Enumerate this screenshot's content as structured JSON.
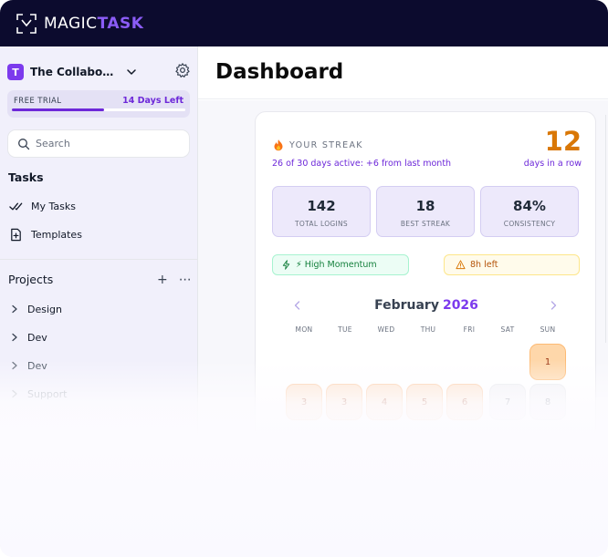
{
  "app": {
    "logo_magic": "MAGIC",
    "logo_task": "TASK",
    "accent": "#7c3aed"
  },
  "sidebar": {
    "workspace": {
      "initial": "T",
      "name": "The Collaborativ..."
    },
    "trial": {
      "label": "FREE TRIAL",
      "days_left": "14 Days Left",
      "progress_fraction": 0.53
    },
    "search": {
      "placeholder": "Search"
    },
    "tasks_title": "Tasks",
    "task_items": [
      {
        "label": "My Tasks",
        "icon": "double-check-icon"
      },
      {
        "label": "Templates",
        "icon": "add-document-icon"
      }
    ],
    "projects_title": "Projects",
    "projects": [
      {
        "label": "Design"
      },
      {
        "label": "Dev"
      },
      {
        "label": "Dev"
      },
      {
        "label": "Support"
      }
    ]
  },
  "main": {
    "title": "Dashboard",
    "streak": {
      "label": "YOUR STREAK",
      "subtitle": "26 of 30 days active: +6 from last month",
      "count": "12",
      "unit": "days in a row",
      "stats": [
        {
          "value": "142",
          "label": "TOTAL LOGINS"
        },
        {
          "value": "18",
          "label": "BEST STREAK"
        },
        {
          "value": "84%",
          "label": "CONSISTENCY"
        }
      ],
      "badges": {
        "momentum": "⚡ High Momentum",
        "time_left": "8h left"
      }
    },
    "calendar": {
      "month": "February",
      "year": "2026",
      "weekdays": [
        "MON",
        "TUE",
        "WED",
        "THU",
        "FRI",
        "SAT",
        "SUN"
      ],
      "days": [
        {
          "label": "1",
          "state": "hot"
        },
        {
          "label": "3",
          "state": "warm"
        },
        {
          "label": "3",
          "state": "warm"
        },
        {
          "label": "4",
          "state": "warm"
        },
        {
          "label": "5",
          "state": "warm"
        },
        {
          "label": "6",
          "state": "warm"
        },
        {
          "label": "7",
          "state": "empty"
        },
        {
          "label": "8",
          "state": "empty"
        }
      ]
    }
  }
}
